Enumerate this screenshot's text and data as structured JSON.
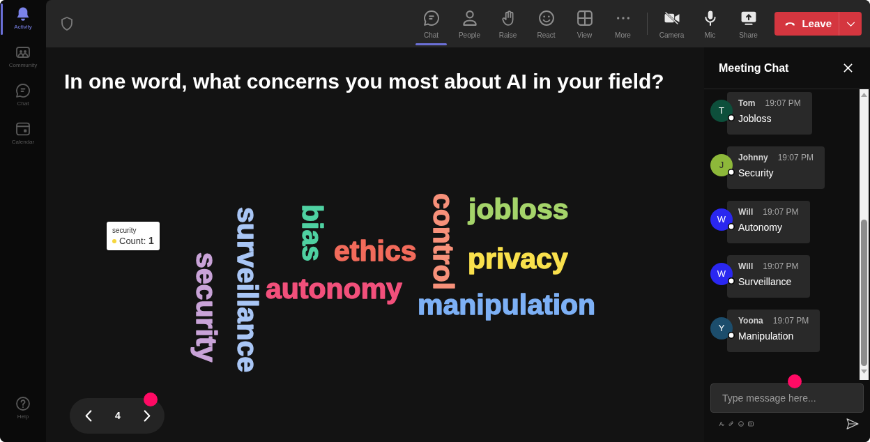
{
  "sidebar": {
    "items": [
      {
        "label": "Activity",
        "selected": true
      },
      {
        "label": "Community",
        "selected": false
      },
      {
        "label": "Chat",
        "selected": false
      },
      {
        "label": "Calendar",
        "selected": false
      }
    ],
    "help": {
      "label": "Help"
    }
  },
  "toolbar": {
    "items": [
      {
        "label": "Chat",
        "selected": true
      },
      {
        "label": "People",
        "selected": false
      },
      {
        "label": "Raise",
        "selected": false
      },
      {
        "label": "React",
        "selected": false
      },
      {
        "label": "View",
        "selected": false
      },
      {
        "label": "More",
        "selected": false
      }
    ],
    "devices": [
      {
        "label": "Camera"
      },
      {
        "label": "Mic"
      },
      {
        "label": "Share"
      }
    ],
    "leave_button": {
      "label": "Leave"
    }
  },
  "slide": {
    "question": "In one word, what concerns you most about AI in your field?",
    "words": [
      {
        "text": "security",
        "kind": "vertical",
        "color": "#c9a3d8"
      },
      {
        "text": "surveillance",
        "kind": "vertical",
        "color": "#a9c6f5"
      },
      {
        "text": "bias",
        "kind": "vertical",
        "color": "#4fd1a2"
      },
      {
        "text": "ethics",
        "kind": "horizontal",
        "color": "#f26b5b"
      },
      {
        "text": "autonomy",
        "kind": "horizontal",
        "color": "#f2507b"
      },
      {
        "text": "control",
        "kind": "vertical",
        "color": "#f7917a"
      },
      {
        "text": "jobloss",
        "kind": "horizontal",
        "color": "#a5d46a"
      },
      {
        "text": "privacy",
        "kind": "horizontal",
        "color": "#f9e04c"
      },
      {
        "text": "manipulation",
        "kind": "horizontal",
        "color": "#7db0f5"
      }
    ],
    "tooltip": {
      "title": "security",
      "text": "Count: **1**",
      "color": "#f5d63d"
    },
    "pagination": {
      "page": "4"
    }
  },
  "chat": {
    "title": "Meeting Chat",
    "messages": [
      {
        "initial": "T",
        "author": "Tom",
        "time": "19:07 PM",
        "text": "Jobloss",
        "color": "#0d4f3b"
      },
      {
        "initial": "J",
        "author": "Johnny",
        "time": "19:07 PM",
        "text": "Security",
        "color": "#8db83a"
      },
      {
        "initial": "W",
        "author": "Will",
        "time": "19:07 PM",
        "text": "Autonomy",
        "color": "#2a27f0"
      },
      {
        "initial": "W",
        "author": "Will",
        "time": "19:07 PM",
        "text": "Surveillance",
        "color": "#2a27f0"
      },
      {
        "initial": "Y",
        "author": "Yoona",
        "time": "19:07 PM",
        "text": "Manipulation",
        "color": "#1c4d6c"
      }
    ],
    "input": {
      "placeholder": "Type message here..."
    }
  }
}
